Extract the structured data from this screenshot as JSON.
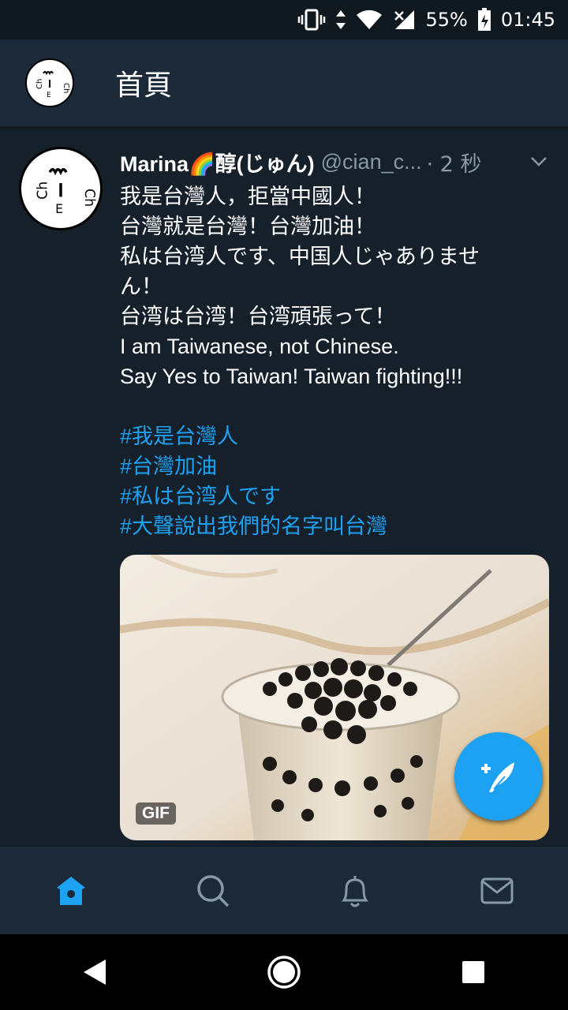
{
  "status_bar": {
    "battery": "55%",
    "time": "01:45"
  },
  "header": {
    "title": "首頁"
  },
  "tweet": {
    "name": "Marina🌈醇(じゅん)",
    "handle": "@cian_c...",
    "time": "· 2 秒",
    "lines": [
      "我是台灣人，拒當中國人！",
      "台灣就是台灣！台灣加油！",
      "私は台湾人です、中国人じゃありませ",
      "ん！",
      "台湾は台湾！台湾頑張って！",
      "I am Taiwanese, not Chinese.",
      "Say Yes to Taiwan! Taiwan fighting!!!"
    ],
    "hashtags": [
      "#我是台灣人",
      "#台灣加油",
      "#私は台湾人です",
      "#大聲說出我們的名字叫台灣"
    ],
    "media_badge": "GIF"
  },
  "colors": {
    "background": "#15202b",
    "bar": "#1c2938",
    "accent": "#1da1f2",
    "muted": "#8899a6"
  },
  "icons": {
    "tabs": [
      "home-icon",
      "search-icon",
      "bell-icon",
      "mail-icon"
    ],
    "nav": [
      "back-icon",
      "home-nav-icon",
      "recents-icon"
    ],
    "fab": "compose-icon"
  }
}
